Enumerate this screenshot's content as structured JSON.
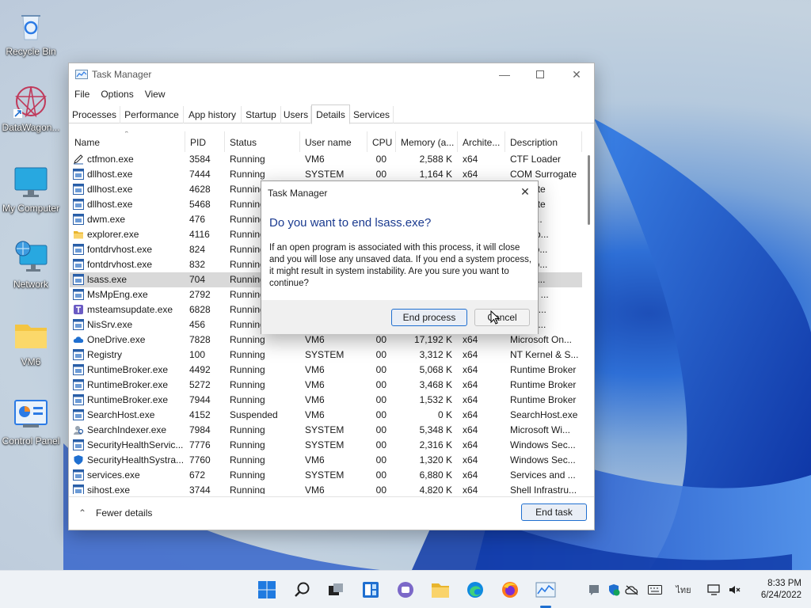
{
  "desktop": {
    "icons": [
      {
        "label": "Recycle Bin"
      },
      {
        "label": "DataWagon..."
      },
      {
        "label": "My Computer"
      },
      {
        "label": "Network"
      },
      {
        "label": "VM6"
      },
      {
        "label": "Control Panel"
      }
    ]
  },
  "task_manager": {
    "title": "Task Manager",
    "menu": [
      "File",
      "Options",
      "View"
    ],
    "tabs": [
      "Processes",
      "Performance",
      "App history",
      "Startup",
      "Users",
      "Details",
      "Services"
    ],
    "active_tab": "Details",
    "columns": [
      "Name",
      "PID",
      "Status",
      "User name",
      "CPU",
      "Memory (a...",
      "Archite...",
      "Description"
    ],
    "rows": [
      {
        "name": "ctfmon.exe",
        "pid": "3584",
        "status": "Running",
        "user": "VM6",
        "cpu": "00",
        "memory": "2,588 K",
        "arch": "x64",
        "desc": "CTF Loader",
        "icon": "pen-icon"
      },
      {
        "name": "dllhost.exe",
        "pid": "7444",
        "status": "Running",
        "user": "SYSTEM",
        "cpu": "00",
        "memory": "1,164 K",
        "arch": "x64",
        "desc": "COM Surrogate",
        "icon": "window-icon"
      },
      {
        "name": "dllhost.exe",
        "pid": "4628",
        "status": "Running",
        "user": "",
        "cpu": "",
        "memory": "",
        "arch": "",
        "desc": "urrogate",
        "icon": "window-icon"
      },
      {
        "name": "dllhost.exe",
        "pid": "5468",
        "status": "Running",
        "user": "",
        "cpu": "",
        "memory": "",
        "arch": "",
        "desc": "urrogate",
        "icon": "window-icon"
      },
      {
        "name": "dwm.exe",
        "pid": "476",
        "status": "Running",
        "user": "",
        "cpu": "",
        "memory": "",
        "arch": "",
        "desc": "p Win...",
        "icon": "window-icon"
      },
      {
        "name": "explorer.exe",
        "pid": "4116",
        "status": "Running",
        "user": "",
        "cpu": "",
        "memory": "",
        "arch": "",
        "desc": "ws Exp...",
        "icon": "folder-icon"
      },
      {
        "name": "fontdrvhost.exe",
        "pid": "824",
        "status": "Running",
        "user": "",
        "cpu": "",
        "memory": "",
        "arch": "",
        "desc": "ode Fo...",
        "icon": "window-icon"
      },
      {
        "name": "fontdrvhost.exe",
        "pid": "832",
        "status": "Running",
        "user": "",
        "cpu": "",
        "memory": "",
        "arch": "",
        "desc": "ode Fo...",
        "icon": "window-icon"
      },
      {
        "name": "lsass.exe",
        "pid": "704",
        "status": "Running",
        "user": "",
        "cpu": "",
        "memory": "",
        "arch": "",
        "desc": "ecurity...",
        "icon": "window-icon",
        "selected": true
      },
      {
        "name": "MsMpEng.exe",
        "pid": "2792",
        "status": "Running",
        "user": "",
        "cpu": "",
        "memory": "",
        "arch": "",
        "desc": "alware ...",
        "icon": "window-icon"
      },
      {
        "name": "msteamsupdate.exe",
        "pid": "6828",
        "status": "Running",
        "user": "",
        "cpu": "",
        "memory": "",
        "arch": "",
        "desc": "oft Tea...",
        "icon": "teams-icon"
      },
      {
        "name": "NisSrv.exe",
        "pid": "456",
        "status": "Running",
        "user": "",
        "cpu": "",
        "memory": "",
        "arch": "",
        "desc": "oft Net...",
        "icon": "window-icon"
      },
      {
        "name": "OneDrive.exe",
        "pid": "7828",
        "status": "Running",
        "user": "VM6",
        "cpu": "00",
        "memory": "17,192 K",
        "arch": "x64",
        "desc": "Microsoft On...",
        "icon": "cloud-icon"
      },
      {
        "name": "Registry",
        "pid": "100",
        "status": "Running",
        "user": "SYSTEM",
        "cpu": "00",
        "memory": "3,312 K",
        "arch": "x64",
        "desc": "NT Kernel & S...",
        "icon": "window-icon"
      },
      {
        "name": "RuntimeBroker.exe",
        "pid": "4492",
        "status": "Running",
        "user": "VM6",
        "cpu": "00",
        "memory": "5,068 K",
        "arch": "x64",
        "desc": "Runtime Broker",
        "icon": "window-icon"
      },
      {
        "name": "RuntimeBroker.exe",
        "pid": "5272",
        "status": "Running",
        "user": "VM6",
        "cpu": "00",
        "memory": "3,468 K",
        "arch": "x64",
        "desc": "Runtime Broker",
        "icon": "window-icon"
      },
      {
        "name": "RuntimeBroker.exe",
        "pid": "7944",
        "status": "Running",
        "user": "VM6",
        "cpu": "00",
        "memory": "1,532 K",
        "arch": "x64",
        "desc": "Runtime Broker",
        "icon": "window-icon"
      },
      {
        "name": "SearchHost.exe",
        "pid": "4152",
        "status": "Suspended",
        "user": "VM6",
        "cpu": "00",
        "memory": "0 K",
        "arch": "x64",
        "desc": "SearchHost.exe",
        "icon": "window-icon"
      },
      {
        "name": "SearchIndexer.exe",
        "pid": "7984",
        "status": "Running",
        "user": "SYSTEM",
        "cpu": "00",
        "memory": "5,348 K",
        "arch": "x64",
        "desc": "Microsoft Wi...",
        "icon": "search-person-icon"
      },
      {
        "name": "SecurityHealthServic...",
        "pid": "7776",
        "status": "Running",
        "user": "SYSTEM",
        "cpu": "00",
        "memory": "2,316 K",
        "arch": "x64",
        "desc": "Windows Sec...",
        "icon": "window-icon"
      },
      {
        "name": "SecurityHealthSystra...",
        "pid": "7760",
        "status": "Running",
        "user": "VM6",
        "cpu": "00",
        "memory": "1,320 K",
        "arch": "x64",
        "desc": "Windows Sec...",
        "icon": "shield-icon"
      },
      {
        "name": "services.exe",
        "pid": "672",
        "status": "Running",
        "user": "SYSTEM",
        "cpu": "00",
        "memory": "6,880 K",
        "arch": "x64",
        "desc": "Services and ...",
        "icon": "window-icon"
      },
      {
        "name": "sihost.exe",
        "pid": "3744",
        "status": "Running",
        "user": "VM6",
        "cpu": "00",
        "memory": "4,820 K",
        "arch": "x64",
        "desc": "Shell Infrastru...",
        "icon": "window-icon"
      }
    ],
    "fewer_details": "Fewer details",
    "end_task": "End task"
  },
  "dialog": {
    "title": "Task Manager",
    "heading": "Do you want to end lsass.exe?",
    "body": "If an open program is associated with this process, it will close and you will lose any unsaved data. If you end a system process, it might result in system instability. Are you sure you want to continue?",
    "end_process": "End process",
    "cancel": "Cancel"
  },
  "taskbar": {
    "tray_language": "ไทย",
    "time": "8:33 PM",
    "date": "6/24/2022"
  }
}
